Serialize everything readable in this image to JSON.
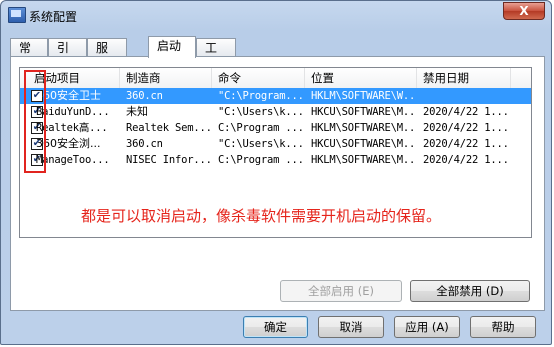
{
  "window": {
    "title": "系统配置",
    "close_label": "X"
  },
  "tabs": [
    {
      "label": "常规"
    },
    {
      "label": "引导"
    },
    {
      "label": "服务"
    },
    {
      "label": "启动",
      "active": true
    },
    {
      "label": "工具"
    }
  ],
  "table": {
    "columns": [
      "启动项目",
      "制造商",
      "命令",
      "位置",
      "禁用日期"
    ],
    "rows": [
      {
        "checked": true,
        "item": "360安全卫士",
        "maker": "360.cn",
        "command": "\"C:\\Program...",
        "location": "HKLM\\SOFTWARE\\W...",
        "date": "",
        "selected": true
      },
      {
        "checked": true,
        "item": "BaiduYunD...",
        "maker": "未知",
        "command": "\"C:\\Users\\k...",
        "location": "HKCU\\SOFTWARE\\M...",
        "date": "2020/4/22 1...",
        "selected": false
      },
      {
        "checked": true,
        "item": "Realtek高...",
        "maker": "Realtek Sem...",
        "command": "C:\\Program ...",
        "location": "HKLM\\SOFTWARE\\M...",
        "date": "2020/4/22 1...",
        "selected": false
      },
      {
        "checked": true,
        "item": "360安全浏...",
        "maker": "360.cn",
        "command": "\"C:\\Users\\k...",
        "location": "HKCU\\SOFTWARE\\M...",
        "date": "2020/4/22 1...",
        "selected": false
      },
      {
        "checked": true,
        "item": "ManageToo...",
        "maker": "NISEC Infor...",
        "command": "C:\\Program ...",
        "location": "HKLM\\SOFTWARE\\M...",
        "date": "2020/4/22 1...",
        "selected": false
      }
    ]
  },
  "annotation": "都是可以取消启动，像杀毒软件需要开机启动的保留。",
  "buttons": {
    "enable_all": "全部启用 (E)",
    "disable_all": "全部禁用 (D)",
    "ok": "确定",
    "cancel": "取消",
    "apply": "应用 (A)",
    "help": "帮助"
  },
  "colors": {
    "selection": "#3399ff",
    "annotation_red": "#e5241b"
  }
}
